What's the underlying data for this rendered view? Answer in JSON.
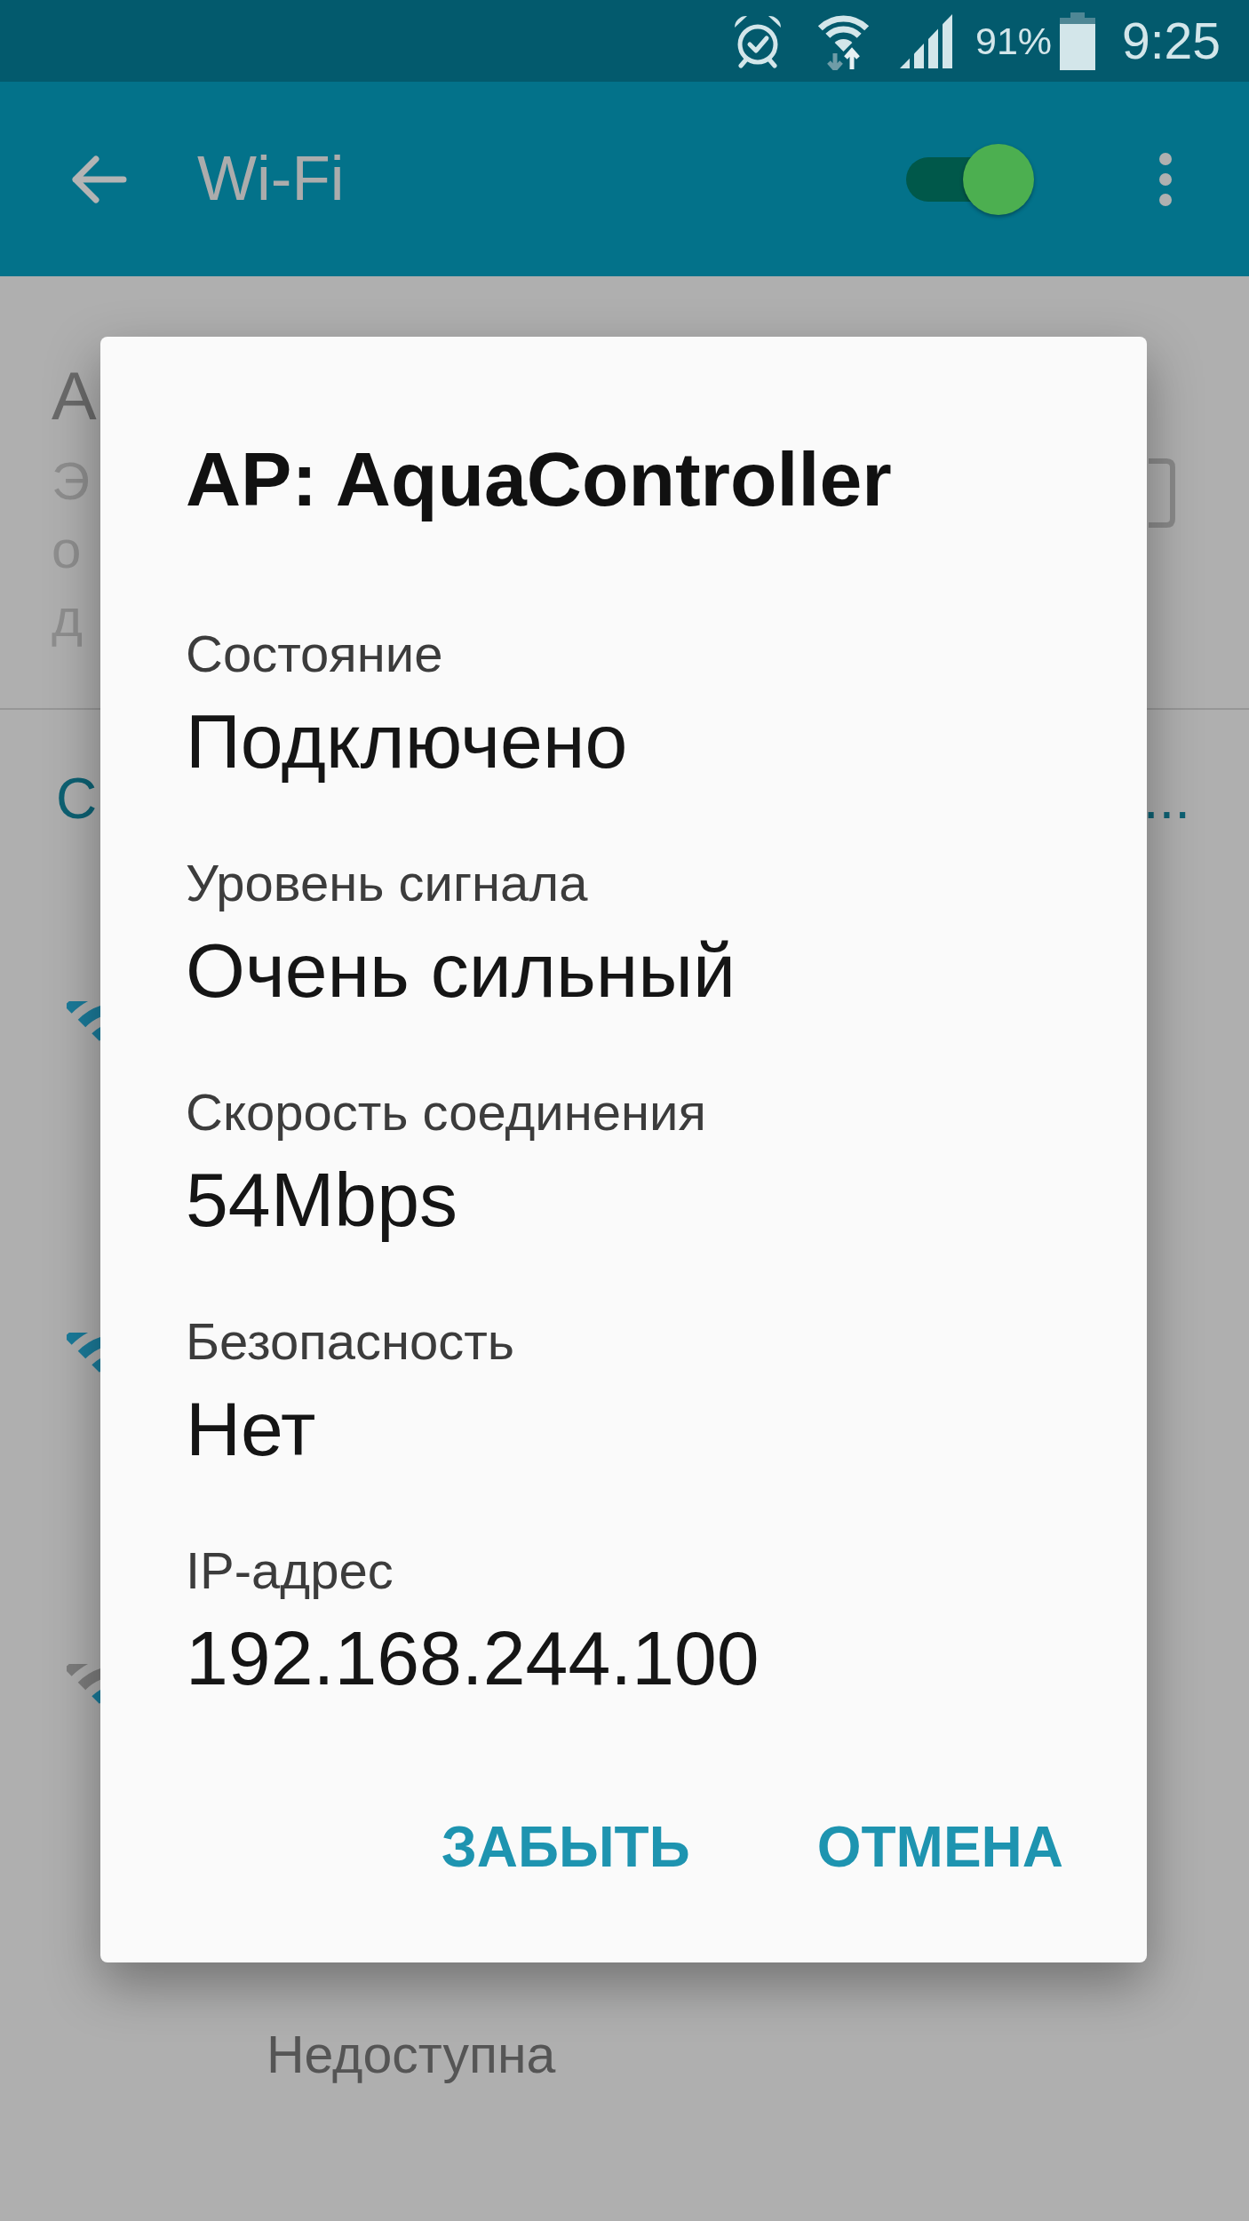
{
  "status_bar": {
    "battery": "91%",
    "time": "9:25"
  },
  "app_bar": {
    "title": "Wi-Fi",
    "toggle": {
      "on": true
    }
  },
  "background": {
    "setting": {
      "title": "A",
      "description_lines": [
        "Э",
        "о",
        "д"
      ],
      "checked": false
    },
    "section_header": {
      "title": "С",
      "trailing": "..."
    },
    "networks": [
      {
        "kind": "strong"
      },
      {
        "kind": "strong"
      },
      {
        "kind": "weak"
      },
      {
        "kind": "unavailable",
        "status": "Недоступна"
      }
    ]
  },
  "dialog": {
    "title": "AP: AquaController",
    "fields": [
      {
        "label": "Состояние",
        "value": "Подключено"
      },
      {
        "label": "Уровень сигнала",
        "value": "Очень сильный"
      },
      {
        "label": "Скорость соединения",
        "value": "54Mbps"
      },
      {
        "label": "Безопасность",
        "value": "Нет"
      },
      {
        "label": "IP-адрес",
        "value": "192.168.244.100"
      }
    ],
    "buttons": [
      "ЗАБЫТЬ",
      "ОТМЕНА"
    ]
  }
}
